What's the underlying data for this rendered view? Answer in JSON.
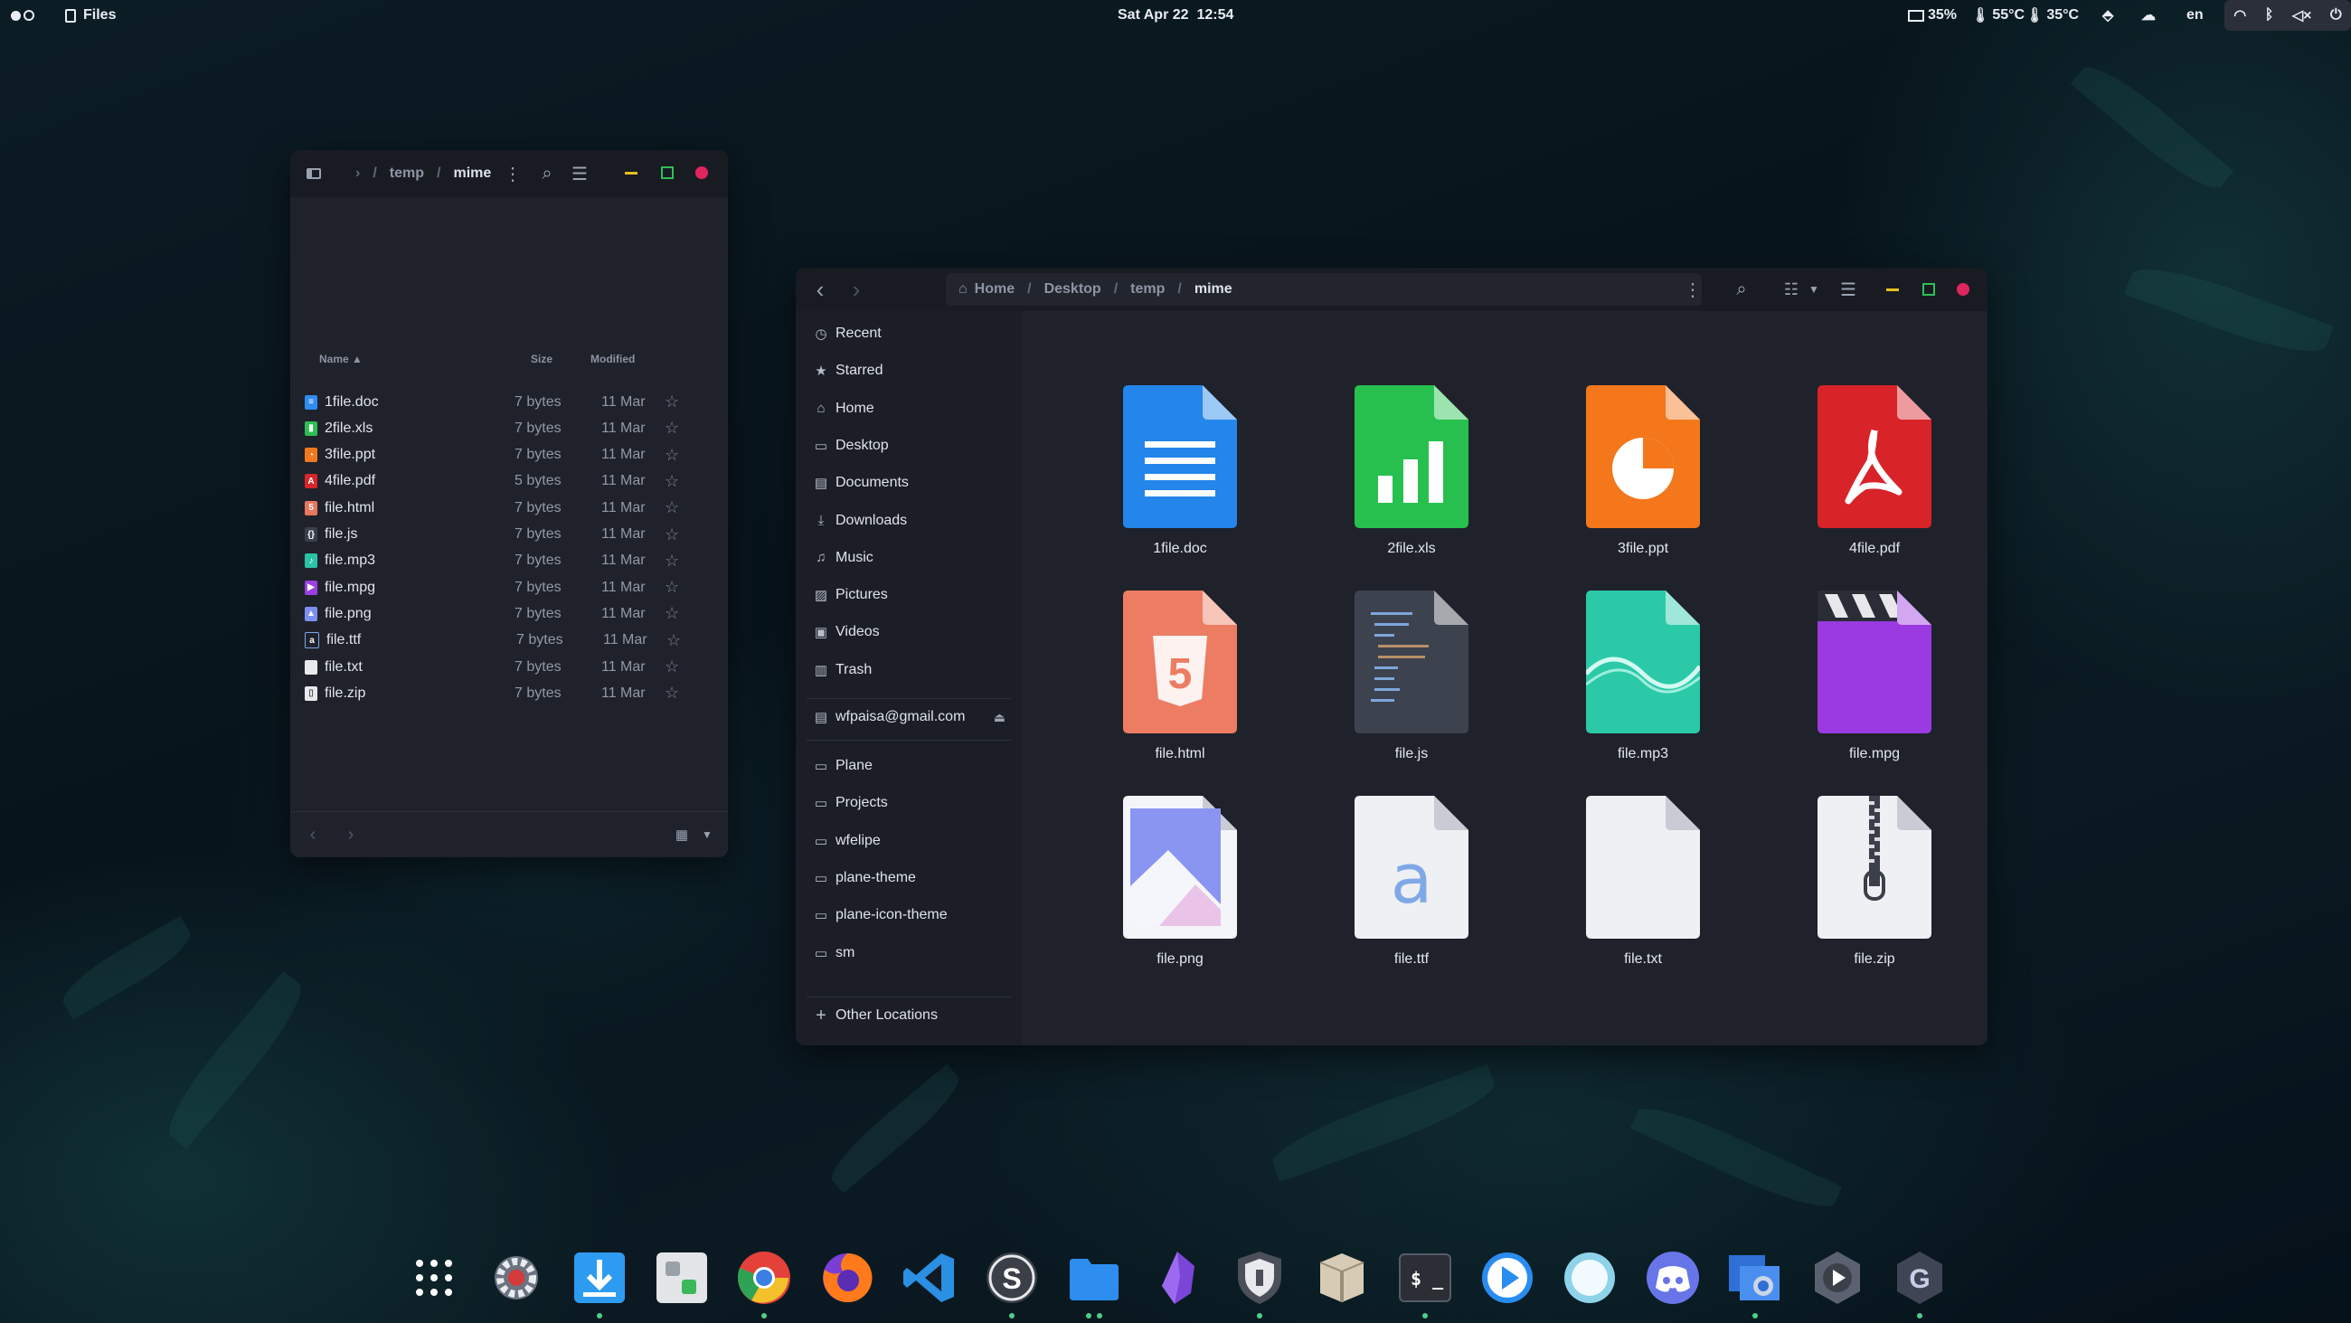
{
  "topbar": {
    "app_name": "Files",
    "datetime": "Sat Apr 22  12:54",
    "battery": "35%",
    "temp1": "55°C",
    "temp2": "35°C",
    "lang": "en"
  },
  "small_window": {
    "crumbs": [
      "temp",
      "mime"
    ],
    "columns": {
      "name": "Name",
      "size": "Size",
      "modified": "Modified"
    },
    "files": [
      {
        "name": "1file.doc",
        "size": "7 bytes",
        "modified": "11 Mar",
        "color": "#2f8cf0",
        "glyph": "≡"
      },
      {
        "name": "2file.xls",
        "size": "7 bytes",
        "modified": "11 Mar",
        "color": "#2ebd55",
        "glyph": "▮"
      },
      {
        "name": "3file.ppt",
        "size": "7 bytes",
        "modified": "11 Mar",
        "color": "#f0781e",
        "glyph": "◔"
      },
      {
        "name": "4file.pdf",
        "size": "5 bytes",
        "modified": "11 Mar",
        "color": "#d8262c",
        "glyph": "A"
      },
      {
        "name": "file.html",
        "size": "7 bytes",
        "modified": "11 Mar",
        "color": "#e8765e",
        "glyph": "5"
      },
      {
        "name": "file.js",
        "size": "7 bytes",
        "modified": "11 Mar",
        "color": "#3a3f4c",
        "glyph": "{}"
      },
      {
        "name": "file.mp3",
        "size": "7 bytes",
        "modified": "11 Mar",
        "color": "#2cc3a5",
        "glyph": "♪"
      },
      {
        "name": "file.mpg",
        "size": "7 bytes",
        "modified": "11 Mar",
        "color": "#9b3fe0",
        "glyph": "▶"
      },
      {
        "name": "file.png",
        "size": "7 bytes",
        "modified": "11 Mar",
        "color": "#7d8ff0",
        "glyph": "▲"
      },
      {
        "name": "file.ttf",
        "size": "7 bytes",
        "modified": "11 Mar",
        "color": "#1f222b",
        "glyph": "a"
      },
      {
        "name": "file.txt",
        "size": "7 bytes",
        "modified": "11 Mar",
        "color": "#e7e9ed",
        "glyph": ""
      },
      {
        "name": "file.zip",
        "size": "7 bytes",
        "modified": "11 Mar",
        "color": "#e7e9ed",
        "glyph": "▯"
      }
    ]
  },
  "main_window": {
    "crumbs": [
      "Home",
      "Desktop",
      "temp",
      "mime"
    ],
    "sidebar_places": [
      {
        "label": "Recent",
        "icon": "clock-icon",
        "glyph": "◷"
      },
      {
        "label": "Starred",
        "icon": "star-icon",
        "glyph": "★"
      },
      {
        "label": "Home",
        "icon": "home-icon",
        "glyph": "⌂"
      },
      {
        "label": "Desktop",
        "icon": "desktop-icon",
        "glyph": "▭"
      },
      {
        "label": "Documents",
        "icon": "documents-icon",
        "glyph": "▤"
      },
      {
        "label": "Downloads",
        "icon": "downloads-icon",
        "glyph": "⤓"
      },
      {
        "label": "Music",
        "icon": "music-icon",
        "glyph": "♫"
      },
      {
        "label": "Pictures",
        "icon": "pictures-icon",
        "glyph": "▨"
      },
      {
        "label": "Videos",
        "icon": "videos-icon",
        "glyph": "▣"
      },
      {
        "label": "Trash",
        "icon": "trash-icon",
        "glyph": "▥"
      }
    ],
    "account": "wfpaisa@gmail.com",
    "bookmarks": [
      "Plane",
      "Projects",
      "wfelipe",
      "plane-theme",
      "plane-icon-theme",
      "sm"
    ],
    "other_locations": "Other Locations",
    "files": [
      "1file.doc",
      "2file.xls",
      "3file.ppt",
      "4file.pdf",
      "file.html",
      "file.js",
      "file.mp3",
      "file.mpg",
      "file.png",
      "file.ttf",
      "file.txt",
      "file.zip"
    ]
  },
  "dock": [
    "app-grid",
    "settings",
    "downloader",
    "tweaks",
    "chrome",
    "firefox",
    "vscode",
    "sublime",
    "files",
    "obsidian",
    "security",
    "archive",
    "terminal",
    "player",
    "ubuntu-circle",
    "discord",
    "screenshot",
    "video-editor",
    "gitkraken"
  ]
}
